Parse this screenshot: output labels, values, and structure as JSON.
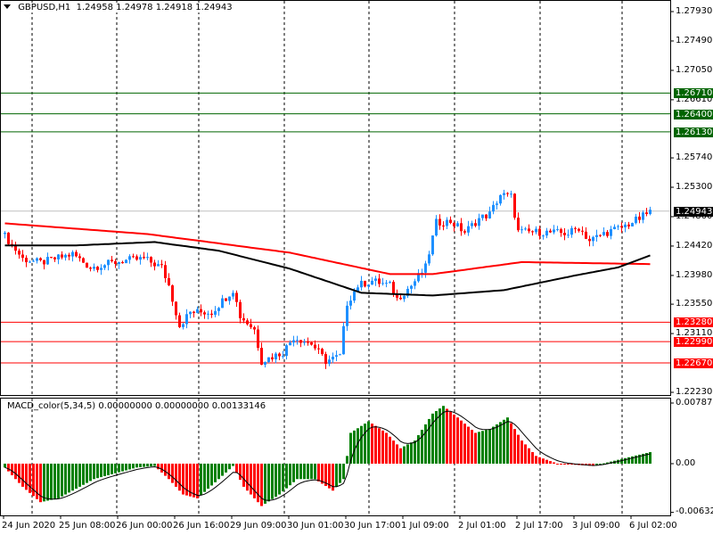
{
  "header": {
    "symbol": "GBPUSD,H1",
    "open": "1.24958",
    "high": "1.24978",
    "low": "1.24918",
    "close": "1.24943"
  },
  "macd_header": {
    "name": "MACD_color(5,34,5)",
    "v1": "0.00000000",
    "v2": "0.00000000",
    "v3": "0.00133146"
  },
  "colors": {
    "bull": "#1e90ff",
    "bear": "#ff0000",
    "support_line": "#ff0000",
    "resistance_line": "#006400",
    "ma_slow": "#ff0000",
    "ma_fast": "#000000",
    "macd_up": "#008000",
    "macd_down": "#ff0000"
  },
  "chart_data": {
    "type": "candlestick",
    "price_axis": {
      "min": 1.2223,
      "max": 1.2793,
      "labels": [
        "1.27930",
        "1.27490",
        "1.27050",
        "1.26610",
        "1.25740",
        "1.25300",
        "1.24860",
        "1.24420",
        "1.23980",
        "1.23550",
        "1.23110",
        "1.22230"
      ]
    },
    "current_price": "1.24943",
    "resistance_levels": [
      "1.26710",
      "1.26400",
      "1.26130"
    ],
    "support_levels": [
      "1.23280",
      "1.22990",
      "1.22670"
    ],
    "time_labels": [
      "24 Jun 2020",
      "25 Jun 08:00",
      "26 Jun 00:00",
      "26 Jun 16:00",
      "29 Jun 09:00",
      "30 Jun 01:00",
      "30 Jun 17:00",
      "1 Jul 09:00",
      "2 Jul 01:00",
      "2 Jul 17:00",
      "3 Jul 09:00",
      "6 Jul 02:00"
    ],
    "bars_per_label": 16,
    "bar_count": 182,
    "close_keypoints": [
      [
        0,
        1.2457
      ],
      [
        5,
        1.2423
      ],
      [
        10,
        1.2417
      ],
      [
        19,
        1.243
      ],
      [
        24,
        1.241
      ],
      [
        33,
        1.242
      ],
      [
        39,
        1.2423
      ],
      [
        44,
        1.241
      ],
      [
        46,
        1.2383
      ],
      [
        49,
        1.2323
      ],
      [
        52,
        1.2343
      ],
      [
        58,
        1.2343
      ],
      [
        64,
        1.2377
      ],
      [
        66,
        1.2337
      ],
      [
        70,
        1.2317
      ],
      [
        72,
        1.227
      ],
      [
        78,
        1.2283
      ],
      [
        81,
        1.2306
      ],
      [
        86,
        1.2296
      ],
      [
        90,
        1.227
      ],
      [
        94,
        1.2277
      ],
      [
        96,
        1.2357
      ],
      [
        99,
        1.2383
      ],
      [
        103,
        1.239
      ],
      [
        108,
        1.2383
      ],
      [
        110,
        1.2363
      ],
      [
        114,
        1.2383
      ],
      [
        118,
        1.241
      ],
      [
        121,
        1.2477
      ],
      [
        125,
        1.2479
      ],
      [
        129,
        1.2463
      ],
      [
        133,
        1.2483
      ],
      [
        136,
        1.249
      ],
      [
        139,
        1.2519
      ],
      [
        142,
        1.2516
      ],
      [
        144,
        1.2463
      ],
      [
        150,
        1.2463
      ],
      [
        158,
        1.2461
      ],
      [
        161,
        1.247
      ],
      [
        164,
        1.245
      ],
      [
        168,
        1.2461
      ],
      [
        173,
        1.247
      ],
      [
        178,
        1.2483
      ],
      [
        181,
        1.2494
      ]
    ],
    "ma_slow_keypoints": [
      [
        0,
        1.2476
      ],
      [
        40,
        1.246
      ],
      [
        80,
        1.2432
      ],
      [
        108,
        1.24
      ],
      [
        120,
        1.24
      ],
      [
        145,
        1.2418
      ],
      [
        181,
        1.2415
      ]
    ],
    "ma_fast_keypoints": [
      [
        0,
        1.2443
      ],
      [
        20,
        1.2443
      ],
      [
        42,
        1.2448
      ],
      [
        60,
        1.2435
      ],
      [
        80,
        1.2408
      ],
      [
        100,
        1.2372
      ],
      [
        120,
        1.2368
      ],
      [
        140,
        1.2376
      ],
      [
        160,
        1.2398
      ],
      [
        172,
        1.241
      ],
      [
        181,
        1.2428
      ]
    ],
    "macd": {
      "min": -0.006323,
      "max": 0.0078738,
      "zero_label": "0.00",
      "max_label": "0.0078738",
      "min_label": "-0.006323",
      "keypoints": [
        [
          0,
          -0.0005
        ],
        [
          5,
          -0.003
        ],
        [
          10,
          -0.005
        ],
        [
          15,
          -0.0045
        ],
        [
          25,
          -0.002
        ],
        [
          37,
          -0.0005
        ],
        [
          42,
          -0.0003
        ],
        [
          46,
          -0.002
        ],
        [
          50,
          -0.004
        ],
        [
          54,
          -0.0045
        ],
        [
          60,
          -0.002
        ],
        [
          64,
          -0.0003
        ],
        [
          67,
          -0.003
        ],
        [
          72,
          -0.0055
        ],
        [
          77,
          -0.004
        ],
        [
          82,
          -0.002
        ],
        [
          87,
          -0.002
        ],
        [
          92,
          -0.0035
        ],
        [
          95,
          -0.002
        ],
        [
          97,
          0.004
        ],
        [
          102,
          0.0055
        ],
        [
          107,
          0.004
        ],
        [
          111,
          0.002
        ],
        [
          115,
          0.003
        ],
        [
          120,
          0.0065
        ],
        [
          123,
          0.0075
        ],
        [
          127,
          0.006
        ],
        [
          132,
          0.004
        ],
        [
          136,
          0.0045
        ],
        [
          141,
          0.006
        ],
        [
          145,
          0.003
        ],
        [
          149,
          0.001
        ],
        [
          155,
          0.0
        ],
        [
          165,
          -0.0003
        ],
        [
          172,
          0.0005
        ],
        [
          181,
          0.0015
        ]
      ]
    }
  }
}
